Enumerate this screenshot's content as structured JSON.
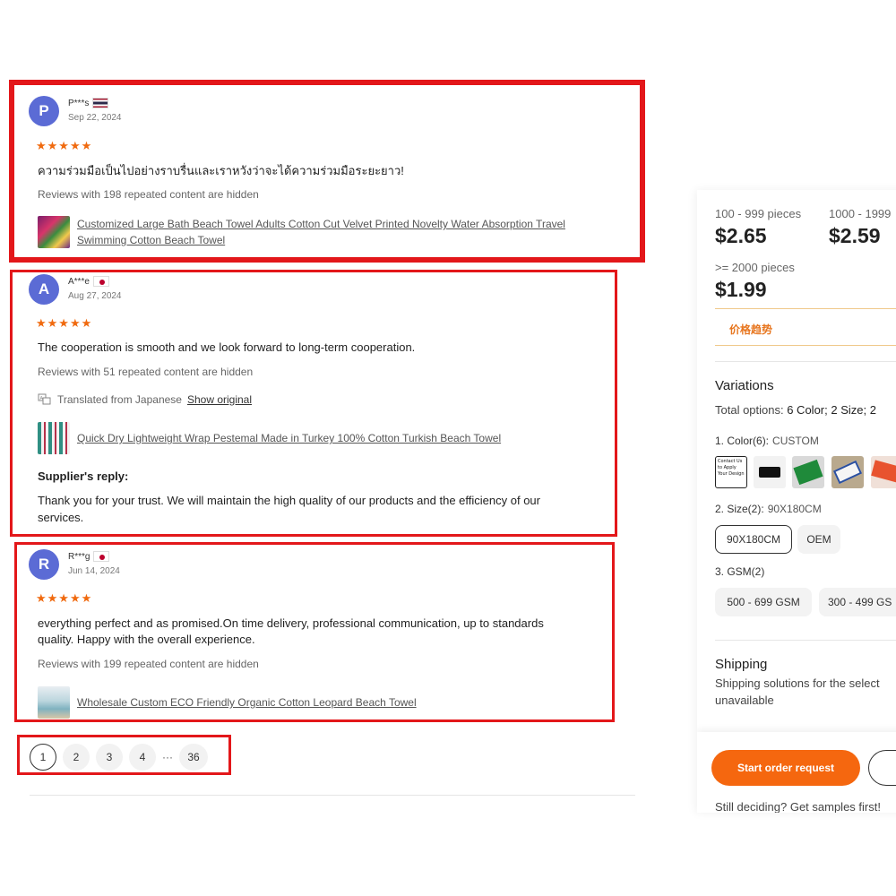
{
  "reviews": [
    {
      "initial": "P",
      "name": "P***s",
      "date": "Sep 22, 2024",
      "stars": "★★★★★",
      "text": "ความร่วมมือเป็นไปอย่างราบรื่นและเราหวังว่าจะได้ความร่วมมือระยะยาว!",
      "hidden_note": "Reviews with 198 repeated content are hidden",
      "product_line1": "Customized Large Bath Beach Towel Adults Cotton Cut Velvet Printed Novelty Water Absorption Travel",
      "product_line2": "Swimming Cotton Beach Towel"
    },
    {
      "initial": "A",
      "name": "A***e",
      "date": "Aug 27, 2024",
      "stars": "★★★★★",
      "text": "The cooperation is smooth and we look forward to long-term cooperation.",
      "hidden_note": "Reviews with 51 repeated content are hidden",
      "translated_label": "Translated from Japanese",
      "show_original": "Show original",
      "product_line1": "Quick Dry Lightweight Wrap Pestemal Made in Turkey 100% Cotton Turkish Beach Towel",
      "reply_title": "Supplier's reply:",
      "reply_line1": "Thank you for your trust. We will maintain the high quality of our products and the efficiency of our",
      "reply_line2": "services."
    },
    {
      "initial": "R",
      "name": "R***g",
      "date": "Jun 14, 2024",
      "stars": "★★★★★",
      "text_line1": "everything perfect and as promised.On time delivery, professional communication, up to standards",
      "text_line2": "quality. Happy with the overall experience.",
      "hidden_note": "Reviews with 199 repeated content are hidden",
      "product_line1": "Wholesale Custom ECO Friendly Organic Cotton Leopard Beach Towel"
    }
  ],
  "pagination": {
    "pages": [
      "1",
      "2",
      "3",
      "4"
    ],
    "ellipsis": "···",
    "last": "36",
    "active": "1"
  },
  "panel": {
    "tiers": [
      {
        "label": "100 - 999 pieces",
        "price": "$2.65"
      },
      {
        "label": "1000 - 1999",
        "price": "$2.59"
      },
      {
        "label": ">= 2000 pieces",
        "price": "$1.99"
      }
    ],
    "trend": "价格趋势",
    "variations_title": "Variations",
    "total_options": "Total options: ",
    "total_options_value": "6 Color; 2 Size; 2",
    "color_label": "1. Color(6):",
    "color_value": "CUSTOM",
    "swatch1_text": "Contact Us to Apply Your Design",
    "size_label": "2. Size(2):",
    "size_value": "90X180CM",
    "sizes": [
      "90X180CM",
      "OEM"
    ],
    "gsm_label": "3. GSM(2)",
    "gsms": [
      "500 - 699 GSM",
      "300 - 499 GS"
    ],
    "shipping_title": "Shipping",
    "shipping_text": "Shipping solutions for the selected quantity are currently unavailable",
    "shipping_line1": "Shipping solutions for the select",
    "shipping_line2": "unavailable",
    "order_button": "Start order request",
    "samples_text": "Still deciding? Get samples first!"
  },
  "colors": {
    "accent": "#f5670f",
    "highlight": "#e3171a",
    "star": "#f06a0f",
    "avatar": "#5b6bd5"
  }
}
